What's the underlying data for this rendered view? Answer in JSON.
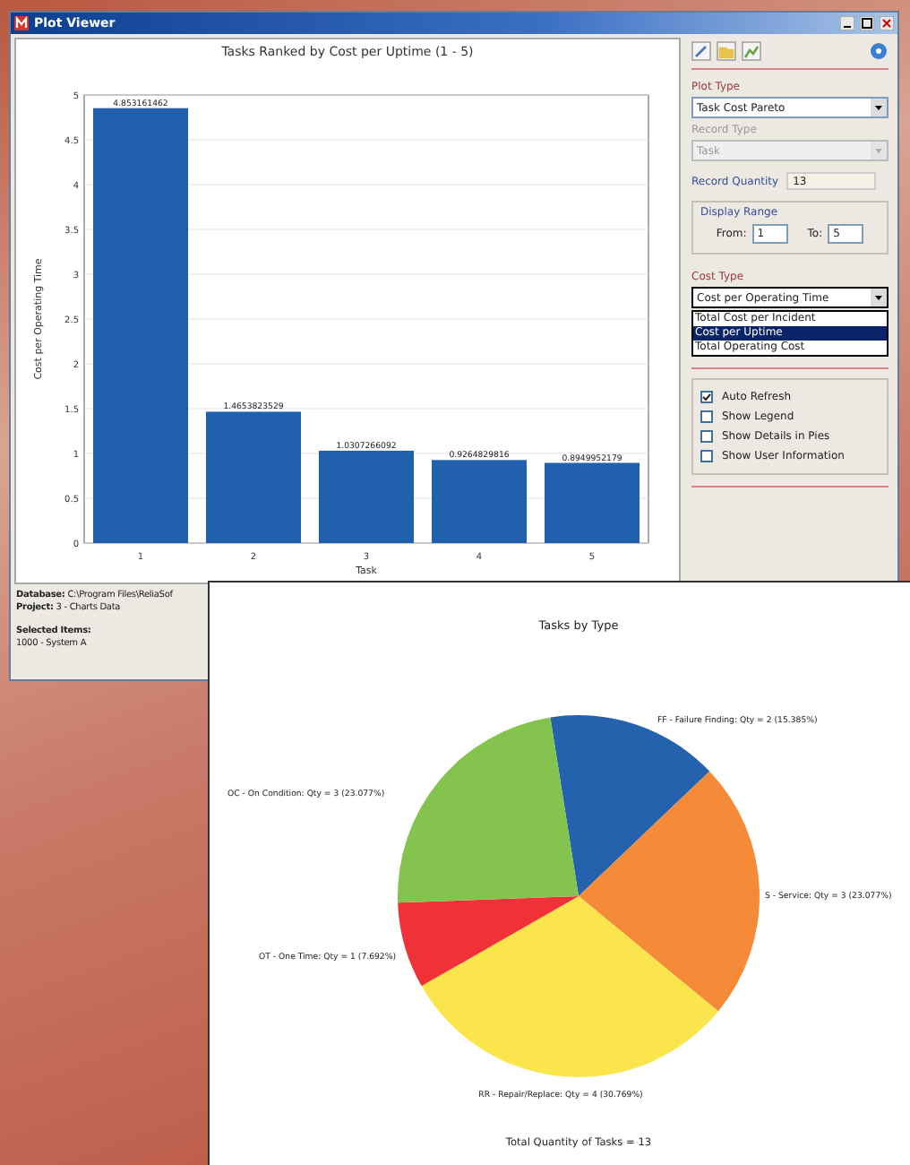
{
  "window": {
    "title": "Plot Viewer"
  },
  "bar_chart": {
    "chart_data": {
      "type": "bar",
      "title": "Tasks Ranked by Cost per Uptime (1 - 5)",
      "xlabel": "Task",
      "ylabel": "Cost per Operating Time",
      "categories": [
        "1",
        "2",
        "3",
        "4",
        "5"
      ],
      "values": [
        4.853161462,
        1.4653823529,
        1.0307266092,
        0.9264829816,
        0.8949952179
      ],
      "grid": true,
      "ylim": [
        0,
        5
      ],
      "yticks": [
        0,
        0.5,
        1,
        1.5,
        2,
        2.5,
        3,
        3.5,
        4,
        4.5,
        5
      ],
      "value_labels": [
        "4.853161462",
        "1.4653823529",
        "1.0307266092",
        "0.9264829816",
        "0.8949952179"
      ]
    }
  },
  "panel": {
    "plot_type": {
      "label": "Plot Type",
      "value": "Task Cost Pareto"
    },
    "record_type": {
      "label": "Record Type",
      "value": "Task",
      "disabled": true
    },
    "record_quantity": {
      "label": "Record Quantity",
      "value": "13"
    },
    "display_range": {
      "label": "Display Range",
      "from_label": "From:",
      "from_value": "1",
      "to_label": "To:",
      "to_value": "5"
    },
    "cost_type": {
      "label": "Cost Type",
      "value": "Cost per Operating Time",
      "expanded": true,
      "options": [
        {
          "label": "Total Cost per Incident",
          "selected": false
        },
        {
          "label": "Cost per Uptime",
          "selected": true
        },
        {
          "label": "Total Operating Cost",
          "selected": false
        }
      ]
    },
    "checkboxes": [
      {
        "label": "Auto Refresh",
        "checked": true
      },
      {
        "label": "Show Legend",
        "checked": false
      },
      {
        "label": "Show Details in Pies",
        "checked": false
      },
      {
        "label": "Show User Information",
        "checked": false
      }
    ]
  },
  "info": [
    {
      "label": "Database:",
      "value": "C:\\Program Files\\ReliaSof"
    },
    {
      "label": "Project:",
      "value": "3 - Charts Data"
    },
    {
      "label": "Selected Items:",
      "value": "1000 - System A"
    }
  ],
  "pie_chart": {
    "chart_data": {
      "type": "pie",
      "title": "Tasks by Type",
      "categories": [
        "FF - Failure Finding: Qty = 2 (15.385%)",
        "S - Service: Qty = 3 (23.077%)",
        "RR - Repair/Replace: Qty = 4 (30.769%)",
        "OT - One Time: Qty = 1 (7.692%)",
        "OC - On Condition: Qty = 3 (23.077%)"
      ],
      "values": [
        2,
        3,
        4,
        1,
        3
      ],
      "colors": [
        "#2462ae",
        "#f58a38",
        "#fbe54d",
        "#ee3238",
        "#84c44e"
      ]
    },
    "footer": "Total Quantity of Tasks = 13"
  }
}
